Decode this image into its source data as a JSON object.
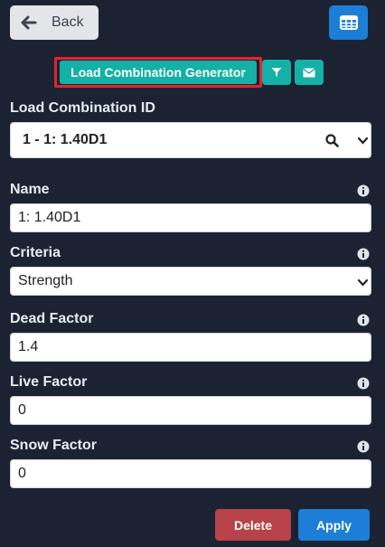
{
  "toolbar": {
    "back_label": "Back",
    "grid_icon": "table-grid-icon",
    "generator_label": "Load Combination Generator",
    "filter_icon": "filter-icon",
    "mail_icon": "envelope-icon"
  },
  "form": {
    "combo_id": {
      "label": "Load Combination ID",
      "value": "1 - 1: 1.40D1"
    },
    "name": {
      "label": "Name",
      "value": "1: 1.40D1"
    },
    "criteria": {
      "label": "Criteria",
      "value": "Strength"
    },
    "dead_factor": {
      "label": "Dead Factor",
      "value": "1.4"
    },
    "live_factor": {
      "label": "Live Factor",
      "value": "0"
    },
    "snow_factor": {
      "label": "Snow Factor",
      "value": "0"
    }
  },
  "actions": {
    "delete_label": "Delete",
    "apply_label": "Apply"
  },
  "colors": {
    "background": "#1b2333",
    "teal": "#15b0a6",
    "blue": "#1c7ed6",
    "delete_red": "#b8424a",
    "highlight_red": "#e5222d"
  }
}
